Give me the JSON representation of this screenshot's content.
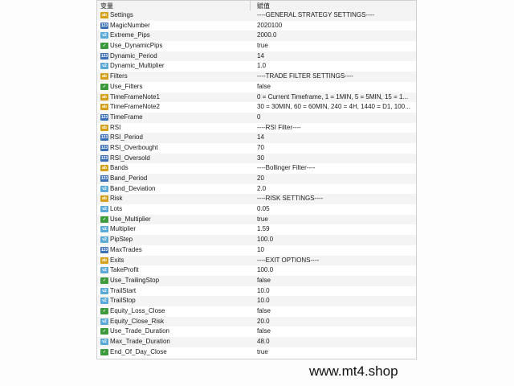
{
  "header": {
    "col_variable": "变量",
    "col_value": "赋值"
  },
  "rows": [
    {
      "name": "Settings",
      "value": "----GENERAL STRATEGY SETTINGS----",
      "icon": "ab-icon"
    },
    {
      "name": "MagicNumber",
      "value": "2020100",
      "icon": "int-icon"
    },
    {
      "name": "Extreme_Pips",
      "value": "2000.0",
      "icon": "double-icon"
    },
    {
      "name": "Use_DynamicPips",
      "value": "true",
      "icon": "bool-icon"
    },
    {
      "name": "Dynamic_Period",
      "value": "14",
      "icon": "int-icon"
    },
    {
      "name": "Dynamic_Multiplier",
      "value": "1.0",
      "icon": "double-icon"
    },
    {
      "name": "Filters",
      "value": "----TRADE FILTER SETTINGS----",
      "icon": "ab-icon"
    },
    {
      "name": "Use_Filters",
      "value": "false",
      "icon": "bool-icon"
    },
    {
      "name": "TimeFrameNote1",
      "value": "0 = Current Timeframe, 1 = 1MIN, 5 = 5MIN, 15 = 1...",
      "icon": "ab-icon"
    },
    {
      "name": "TimeFrameNote2",
      "value": "30 = 30MIN, 60 = 60MIN, 240 = 4H, 1440 = D1, 100...",
      "icon": "ab-icon"
    },
    {
      "name": "TimeFrame",
      "value": "0",
      "icon": "int-icon"
    },
    {
      "name": "RSI",
      "value": "----RSI Filter----",
      "icon": "ab-icon"
    },
    {
      "name": "RSI_Period",
      "value": "14",
      "icon": "int-icon"
    },
    {
      "name": "RSI_Overbought",
      "value": "70",
      "icon": "int-icon"
    },
    {
      "name": "RSI_Oversold",
      "value": "30",
      "icon": "int-icon"
    },
    {
      "name": "Bands",
      "value": "----Bollinger Filter----",
      "icon": "ab-icon"
    },
    {
      "name": "Band_Period",
      "value": "20",
      "icon": "int-icon"
    },
    {
      "name": "Band_Deviation",
      "value": "2.0",
      "icon": "double-icon"
    },
    {
      "name": "Risk",
      "value": "----RISK SETTINGS----",
      "icon": "ab-icon"
    },
    {
      "name": "Lots",
      "value": "0.05",
      "icon": "double-icon"
    },
    {
      "name": "Use_Multiplier",
      "value": "true",
      "icon": "bool-icon"
    },
    {
      "name": "Multiplier",
      "value": "1.59",
      "icon": "double-icon"
    },
    {
      "name": "PipStep",
      "value": "100.0",
      "icon": "double-icon"
    },
    {
      "name": "MaxTrades",
      "value": "10",
      "icon": "int-icon"
    },
    {
      "name": "Exits",
      "value": "----EXIT OPTIONS----",
      "icon": "ab-icon"
    },
    {
      "name": "TakeProfit",
      "value": "100.0",
      "icon": "double-icon"
    },
    {
      "name": "Use_TrailingStop",
      "value": "false",
      "icon": "bool-icon"
    },
    {
      "name": "TrailStart",
      "value": "10.0",
      "icon": "double-icon"
    },
    {
      "name": "TrailStop",
      "value": "10.0",
      "icon": "double-icon"
    },
    {
      "name": "Equity_Loss_Close",
      "value": "false",
      "icon": "bool-icon"
    },
    {
      "name": "Equity_Close_Risk",
      "value": "20.0",
      "icon": "double-icon"
    },
    {
      "name": "Use_Trade_Duration",
      "value": "false",
      "icon": "bool-icon"
    },
    {
      "name": "Max_Trade_Duration",
      "value": "48.0",
      "icon": "double-icon"
    },
    {
      "name": "End_Of_Day_Close",
      "value": "true",
      "icon": "bool-icon"
    }
  ],
  "watermark": "www.mt4.shop"
}
